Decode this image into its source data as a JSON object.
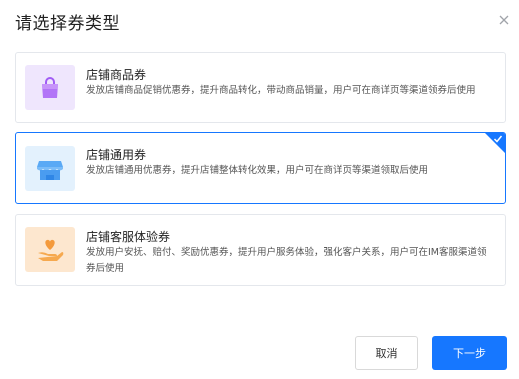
{
  "dialog": {
    "title": "请选择券类型",
    "close_icon": "close-icon"
  },
  "options": [
    {
      "name": "店铺商品券",
      "description": "发放店铺商品促销优惠券，提升商品转化，带动商品销量，用户可在商详页等渠道领券后使用",
      "icon": "shopping-bag-icon",
      "icon_bg": "#efe6fd",
      "selected": false
    },
    {
      "name": "店铺通用券",
      "description": "发放店铺通用优惠券，提升店铺整体转化效果，用户可在商详页等渠道领取后使用",
      "icon": "storefront-icon",
      "icon_bg": "#e3f1fd",
      "selected": true
    },
    {
      "name": "店铺客服体验券",
      "description": "发放用户安抚、赔付、奖励优惠券，提升用户服务体验，强化客户关系，用户可在IM客服渠道领券后使用",
      "icon": "heart-hand-icon",
      "icon_bg": "#fde7cf",
      "selected": false
    }
  ],
  "footer": {
    "cancel_label": "取消",
    "next_label": "下一步"
  },
  "colors": {
    "accent": "#1677ff"
  }
}
